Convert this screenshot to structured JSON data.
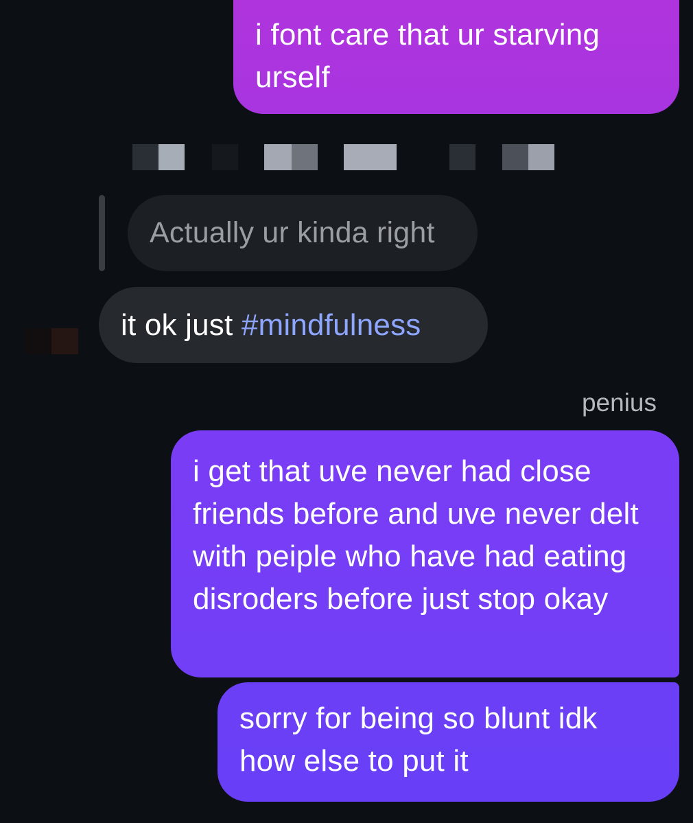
{
  "messages": {
    "sent_1": "i font care that ur starving urself",
    "reply_quote": "Actually ur kinda right",
    "received_1_prefix": "it ok just ",
    "received_1_hashtag": "#mindfulness",
    "sender_name": "penius",
    "sent_2": "i get that uve never had close friends before and uve never delt with peiple who have had eating disroders before just stop okay",
    "sent_3": "sorry for being so blunt idk how else to put it"
  },
  "colors": {
    "background": "#0c1014",
    "sent_bubble_top": "#b134dd",
    "sent_bubble_bottom": "#6b3ff6",
    "received_bubble": "#262a2f",
    "hashtag": "#8fa6ff"
  },
  "icons": {
    "censored_username": "pixelated-block",
    "avatar": "pixelated-avatar"
  }
}
